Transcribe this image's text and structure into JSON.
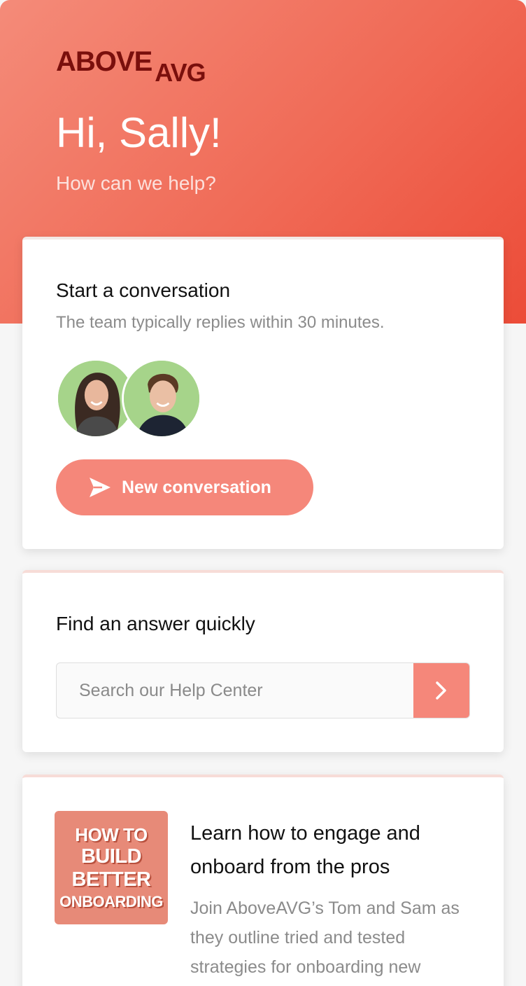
{
  "brand": {
    "logo_part1": "ABOVE",
    "logo_part2": "AVG",
    "color_primary": "#f06a56",
    "color_logo": "#7a0f0c",
    "color_button": "#f5877a"
  },
  "header": {
    "greeting": "Hi, Sally!",
    "subtitle": "How can we help?"
  },
  "conversation_card": {
    "title": "Start a conversation",
    "reply_time": "The team typically replies within 30 minutes.",
    "team_avatars": [
      "team-member-woman",
      "team-member-man"
    ],
    "button_label": "New conversation",
    "button_icon": "send-icon"
  },
  "search_card": {
    "title": "Find an answer quickly",
    "placeholder": "Search our Help Center",
    "value": "",
    "submit_icon": "chevron-right-icon"
  },
  "article_card": {
    "thumbnail_lines": [
      "HOW TO",
      "BUILD",
      "BETTER",
      "ONBOARDING"
    ],
    "title": "Learn how to engage and onboard from the pros",
    "description": "Join AboveAVG’s Tom and Sam as they outline tried and tested strategies for onboarding new"
  }
}
